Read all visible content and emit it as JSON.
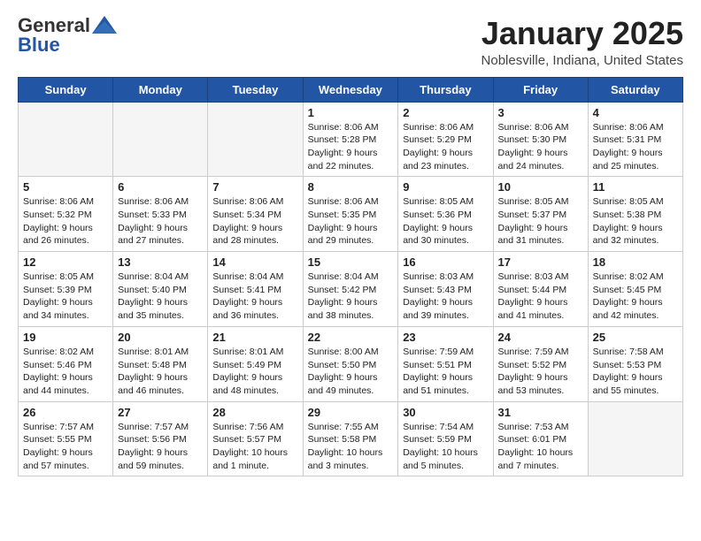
{
  "header": {
    "logo_general": "General",
    "logo_blue": "Blue",
    "title": "January 2025",
    "location": "Noblesville, Indiana, United States"
  },
  "days_of_week": [
    "Sunday",
    "Monday",
    "Tuesday",
    "Wednesday",
    "Thursday",
    "Friday",
    "Saturday"
  ],
  "weeks": [
    [
      {
        "day": "",
        "empty": true
      },
      {
        "day": "",
        "empty": true
      },
      {
        "day": "",
        "empty": true
      },
      {
        "day": "1",
        "sunrise": "8:06 AM",
        "sunset": "5:28 PM",
        "daylight": "9 hours and 22 minutes."
      },
      {
        "day": "2",
        "sunrise": "8:06 AM",
        "sunset": "5:29 PM",
        "daylight": "9 hours and 23 minutes."
      },
      {
        "day": "3",
        "sunrise": "8:06 AM",
        "sunset": "5:30 PM",
        "daylight": "9 hours and 24 minutes."
      },
      {
        "day": "4",
        "sunrise": "8:06 AM",
        "sunset": "5:31 PM",
        "daylight": "9 hours and 25 minutes."
      }
    ],
    [
      {
        "day": "5",
        "sunrise": "8:06 AM",
        "sunset": "5:32 PM",
        "daylight": "9 hours and 26 minutes."
      },
      {
        "day": "6",
        "sunrise": "8:06 AM",
        "sunset": "5:33 PM",
        "daylight": "9 hours and 27 minutes."
      },
      {
        "day": "7",
        "sunrise": "8:06 AM",
        "sunset": "5:34 PM",
        "daylight": "9 hours and 28 minutes."
      },
      {
        "day": "8",
        "sunrise": "8:06 AM",
        "sunset": "5:35 PM",
        "daylight": "9 hours and 29 minutes."
      },
      {
        "day": "9",
        "sunrise": "8:05 AM",
        "sunset": "5:36 PM",
        "daylight": "9 hours and 30 minutes."
      },
      {
        "day": "10",
        "sunrise": "8:05 AM",
        "sunset": "5:37 PM",
        "daylight": "9 hours and 31 minutes."
      },
      {
        "day": "11",
        "sunrise": "8:05 AM",
        "sunset": "5:38 PM",
        "daylight": "9 hours and 32 minutes."
      }
    ],
    [
      {
        "day": "12",
        "sunrise": "8:05 AM",
        "sunset": "5:39 PM",
        "daylight": "9 hours and 34 minutes."
      },
      {
        "day": "13",
        "sunrise": "8:04 AM",
        "sunset": "5:40 PM",
        "daylight": "9 hours and 35 minutes."
      },
      {
        "day": "14",
        "sunrise": "8:04 AM",
        "sunset": "5:41 PM",
        "daylight": "9 hours and 36 minutes."
      },
      {
        "day": "15",
        "sunrise": "8:04 AM",
        "sunset": "5:42 PM",
        "daylight": "9 hours and 38 minutes."
      },
      {
        "day": "16",
        "sunrise": "8:03 AM",
        "sunset": "5:43 PM",
        "daylight": "9 hours and 39 minutes."
      },
      {
        "day": "17",
        "sunrise": "8:03 AM",
        "sunset": "5:44 PM",
        "daylight": "9 hours and 41 minutes."
      },
      {
        "day": "18",
        "sunrise": "8:02 AM",
        "sunset": "5:45 PM",
        "daylight": "9 hours and 42 minutes."
      }
    ],
    [
      {
        "day": "19",
        "sunrise": "8:02 AM",
        "sunset": "5:46 PM",
        "daylight": "9 hours and 44 minutes."
      },
      {
        "day": "20",
        "sunrise": "8:01 AM",
        "sunset": "5:48 PM",
        "daylight": "9 hours and 46 minutes."
      },
      {
        "day": "21",
        "sunrise": "8:01 AM",
        "sunset": "5:49 PM",
        "daylight": "9 hours and 48 minutes."
      },
      {
        "day": "22",
        "sunrise": "8:00 AM",
        "sunset": "5:50 PM",
        "daylight": "9 hours and 49 minutes."
      },
      {
        "day": "23",
        "sunrise": "7:59 AM",
        "sunset": "5:51 PM",
        "daylight": "9 hours and 51 minutes."
      },
      {
        "day": "24",
        "sunrise": "7:59 AM",
        "sunset": "5:52 PM",
        "daylight": "9 hours and 53 minutes."
      },
      {
        "day": "25",
        "sunrise": "7:58 AM",
        "sunset": "5:53 PM",
        "daylight": "9 hours and 55 minutes."
      }
    ],
    [
      {
        "day": "26",
        "sunrise": "7:57 AM",
        "sunset": "5:55 PM",
        "daylight": "9 hours and 57 minutes."
      },
      {
        "day": "27",
        "sunrise": "7:57 AM",
        "sunset": "5:56 PM",
        "daylight": "9 hours and 59 minutes."
      },
      {
        "day": "28",
        "sunrise": "7:56 AM",
        "sunset": "5:57 PM",
        "daylight": "10 hours and 1 minute."
      },
      {
        "day": "29",
        "sunrise": "7:55 AM",
        "sunset": "5:58 PM",
        "daylight": "10 hours and 3 minutes."
      },
      {
        "day": "30",
        "sunrise": "7:54 AM",
        "sunset": "5:59 PM",
        "daylight": "10 hours and 5 minutes."
      },
      {
        "day": "31",
        "sunrise": "7:53 AM",
        "sunset": "6:01 PM",
        "daylight": "10 hours and 7 minutes."
      },
      {
        "day": "",
        "empty": true
      }
    ]
  ],
  "labels": {
    "sunrise": "Sunrise:",
    "sunset": "Sunset:",
    "daylight": "Daylight hours"
  }
}
